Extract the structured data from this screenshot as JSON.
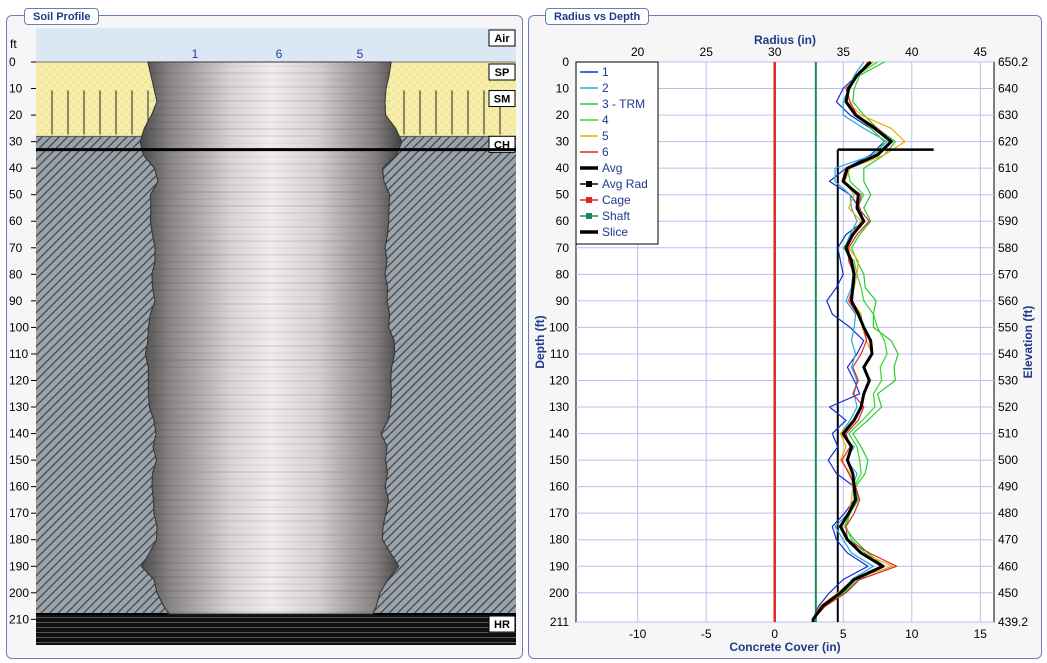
{
  "soil_panel": {
    "title": "Soil Profile",
    "unit": "ft",
    "depth_ticks": [
      "0",
      "10",
      "20",
      "30",
      "40",
      "50",
      "60",
      "70",
      "80",
      "90",
      "100",
      "110",
      "120",
      "130",
      "140",
      "150",
      "160",
      "170",
      "180",
      "190",
      "200",
      "210"
    ],
    "depth_max": 211,
    "layers": [
      {
        "label": "Air",
        "from": -3,
        "to": 0,
        "color": "#dfeaf5"
      },
      {
        "label": "SP",
        "from": 0,
        "to": 10,
        "color": "#f5eca6"
      },
      {
        "label": "SM",
        "from": 10,
        "to": 28,
        "color": "#f5eca6"
      },
      {
        "label": "CH",
        "from": 28,
        "to": 208,
        "color": "#9ba3ab"
      },
      {
        "label": "HR",
        "from": 208,
        "to": 220,
        "color": "#2a2a2a"
      }
    ],
    "profile_labels": [
      "1",
      "6",
      "5"
    ]
  },
  "radius_panel": {
    "title": "Radius vs Depth",
    "top_axis_label": "Radius (in)",
    "bottom_axis_label": "Concrete Cover (in)",
    "left_axis_label": "Depth (ft)",
    "right_axis_label": "Elevation (ft)",
    "radius_ticks": [
      "20",
      "25",
      "30",
      "35",
      "40",
      "45"
    ],
    "cover_ticks": [
      "-10",
      "-5",
      "0",
      "5",
      "10",
      "15"
    ],
    "depth_ticks": [
      "0",
      "10",
      "20",
      "30",
      "40",
      "50",
      "60",
      "70",
      "80",
      "90",
      "100",
      "110",
      "120",
      "130",
      "140",
      "150",
      "160",
      "170",
      "180",
      "190",
      "200",
      "211"
    ],
    "elevation_ticks": [
      "650.2",
      "640",
      "630",
      "620",
      "610",
      "600",
      "590",
      "580",
      "570",
      "560",
      "550",
      "540",
      "530",
      "520",
      "510",
      "500",
      "490",
      "480",
      "470",
      "460",
      "450",
      "439.2"
    ],
    "legend": [
      {
        "label": "1",
        "color": "#1030d0",
        "style": "line"
      },
      {
        "label": "2",
        "color": "#29a8e0",
        "style": "line"
      },
      {
        "label": "3 - TRM",
        "color": "#2ec82e",
        "style": "line"
      },
      {
        "label": "4",
        "color": "#39d631",
        "style": "line"
      },
      {
        "label": "5",
        "color": "#f2a900",
        "style": "line"
      },
      {
        "label": "6",
        "color": "#e02828",
        "style": "line"
      },
      {
        "label": "Avg",
        "color": "#000000",
        "style": "thick"
      },
      {
        "label": "Avg Rad",
        "color": "#000000",
        "style": "marker"
      },
      {
        "label": "Cage",
        "color": "#e02828",
        "style": "marker"
      },
      {
        "label": "Shaft",
        "color": "#1a8a5a",
        "style": "marker"
      },
      {
        "label": "Slice",
        "color": "#000000",
        "style": "thick"
      }
    ]
  },
  "chart_data": {
    "type": "line",
    "title": "Radius vs Depth",
    "xlabel": "Radius (in)",
    "x2label": "Concrete Cover (in)",
    "ylabel": "Depth (ft)",
    "y2label": "Elevation (ft)",
    "xlim": [
      15.5,
      46
    ],
    "x2lim": [
      -15,
      16
    ],
    "ylim": [
      0,
      211
    ],
    "y2lim": [
      650.2,
      439.2
    ],
    "cage_radius": 30,
    "shaft_radius": 33,
    "avg_radius": 34.6,
    "slice": {
      "depth": 33,
      "radius_from": 34.6,
      "radius_to": 41.6
    },
    "depth": [
      0,
      5,
      10,
      15,
      20,
      25,
      30,
      35,
      40,
      45,
      50,
      55,
      60,
      65,
      70,
      75,
      80,
      85,
      90,
      95,
      100,
      105,
      110,
      115,
      120,
      125,
      130,
      135,
      140,
      145,
      150,
      155,
      160,
      165,
      170,
      175,
      180,
      185,
      190,
      195,
      200,
      205,
      210,
      211
    ],
    "series": [
      {
        "name": "1",
        "values": [
          37.0,
          36.0,
          35.0,
          34.5,
          35.5,
          37.0,
          38.0,
          37.0,
          35.2,
          34.0,
          35.5,
          36.2,
          36.5,
          35.2,
          34.6,
          34.8,
          35.0,
          34.5,
          33.8,
          34.2,
          35.5,
          36.5,
          36.0,
          35.3,
          35.8,
          36.2,
          34.0,
          35.2,
          34.2,
          34.6,
          33.9,
          34.5,
          35.8,
          35.8,
          35.1,
          34.2,
          34.5,
          35.3,
          36.8,
          35.0,
          34.0,
          33.2,
          32.8,
          32.8
        ]
      },
      {
        "name": "2",
        "values": [
          36.5,
          35.8,
          35.4,
          35.0,
          35.0,
          36.5,
          38.2,
          37.2,
          34.4,
          34.4,
          35.5,
          35.6,
          36.0,
          35.5,
          35.1,
          35.5,
          35.7,
          35.6,
          35.2,
          35.9,
          35.8,
          35.6,
          35.9,
          35.6,
          36.0,
          35.8,
          36.0,
          35.5,
          34.8,
          35.8,
          35.2,
          36.0,
          35.7,
          35.8,
          35.4,
          34.4,
          35.0,
          35.6,
          37.2,
          35.6,
          35.0,
          33.4,
          32.8,
          32.8
        ]
      },
      {
        "name": "3 - TRM",
        "values": [
          38.0,
          36.2,
          35.8,
          35.7,
          36.5,
          37.5,
          38.8,
          38.0,
          36.5,
          36.5,
          37.0,
          36.5,
          37.0,
          36.2,
          35.6,
          36.0,
          36.5,
          36.6,
          37.4,
          37.2,
          37.2,
          38.5,
          39.0,
          38.7,
          38.8,
          37.5,
          37.8,
          36.8,
          35.7,
          36.3,
          36.8,
          36.6,
          35.9,
          36.1,
          35.5,
          35.1,
          35.8,
          36.8,
          38.0,
          36.1,
          35.1,
          33.6,
          32.8,
          32.8
        ]
      },
      {
        "name": "4",
        "values": [
          37.5,
          36.0,
          35.5,
          35.2,
          36.0,
          37.0,
          38.0,
          37.4,
          35.3,
          35.5,
          36.5,
          36.0,
          36.4,
          35.8,
          35.0,
          35.8,
          36.0,
          36.3,
          36.5,
          37.2,
          37.5,
          38.0,
          38.2,
          37.7,
          37.8,
          37.2,
          37.3,
          36.4,
          35.4,
          36.0,
          36.2,
          36.3,
          35.8,
          36.0,
          35.5,
          35.2,
          35.6,
          36.6,
          37.8,
          35.9,
          35.0,
          33.5,
          32.8,
          32.8
        ]
      },
      {
        "name": "5",
        "values": [
          37.2,
          35.9,
          35.4,
          35.3,
          36.3,
          38.5,
          39.5,
          38.0,
          35.5,
          35.1,
          35.8,
          35.4,
          36.3,
          35.6,
          35.4,
          36.1,
          36.0,
          35.8,
          35.6,
          36.3,
          36.4,
          36.7,
          37.1,
          36.5,
          37.0,
          36.5,
          36.4,
          35.7,
          34.8,
          35.2,
          34.8,
          35.5,
          35.7,
          35.6,
          35.4,
          34.7,
          35.4,
          36.4,
          38.6,
          35.7,
          34.6,
          33.3,
          32.8,
          32.8
        ]
      },
      {
        "name": "6",
        "values": [
          36.8,
          36.1,
          35.2,
          35.5,
          36.0,
          37.5,
          38.6,
          37.6,
          35.2,
          34.9,
          36.3,
          36.1,
          36.9,
          36.0,
          35.4,
          35.4,
          35.8,
          35.7,
          35.4,
          36.0,
          36.5,
          36.7,
          36.3,
          35.7,
          36.1,
          35.7,
          36.5,
          36.1,
          35.2,
          35.5,
          34.9,
          35.4,
          35.9,
          36.2,
          35.8,
          35.2,
          35.3,
          36.9,
          38.9,
          36.2,
          35.2,
          33.7,
          32.8,
          32.8
        ]
      },
      {
        "name": "Avg",
        "values": [
          37.0,
          36.0,
          35.4,
          35.2,
          35.9,
          37.3,
          38.5,
          37.5,
          35.3,
          35.0,
          36.1,
          36.0,
          36.5,
          35.7,
          35.2,
          35.6,
          35.8,
          35.7,
          35.6,
          36.1,
          36.5,
          37.0,
          37.1,
          36.5,
          36.9,
          36.5,
          36.3,
          35.8,
          35.0,
          35.6,
          35.3,
          35.7,
          35.8,
          35.9,
          35.4,
          34.8,
          35.3,
          36.3,
          37.9,
          35.8,
          34.8,
          33.5,
          32.8,
          32.8
        ]
      }
    ]
  }
}
